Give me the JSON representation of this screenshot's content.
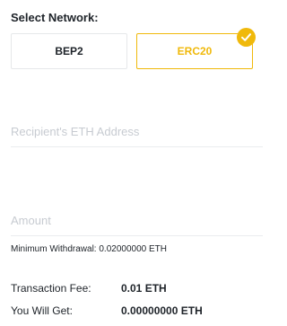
{
  "network": {
    "label": "Select Network:",
    "options": [
      {
        "label": "BEP2",
        "selected": false
      },
      {
        "label": "ERC20",
        "selected": true
      }
    ],
    "selected_icon": "checkmark-icon",
    "accent_color": "#f0b90b"
  },
  "address": {
    "placeholder": "Recipient's ETH Address"
  },
  "amount": {
    "placeholder": "Amount"
  },
  "min_withdrawal": {
    "label": "Minimum Withdrawal:",
    "value": "0.02000000 ETH"
  },
  "fee": {
    "label": "Transaction Fee:",
    "value": "0.01 ETH"
  },
  "receive": {
    "label": "You Will Get:",
    "value": "0.00000000 ETH"
  }
}
